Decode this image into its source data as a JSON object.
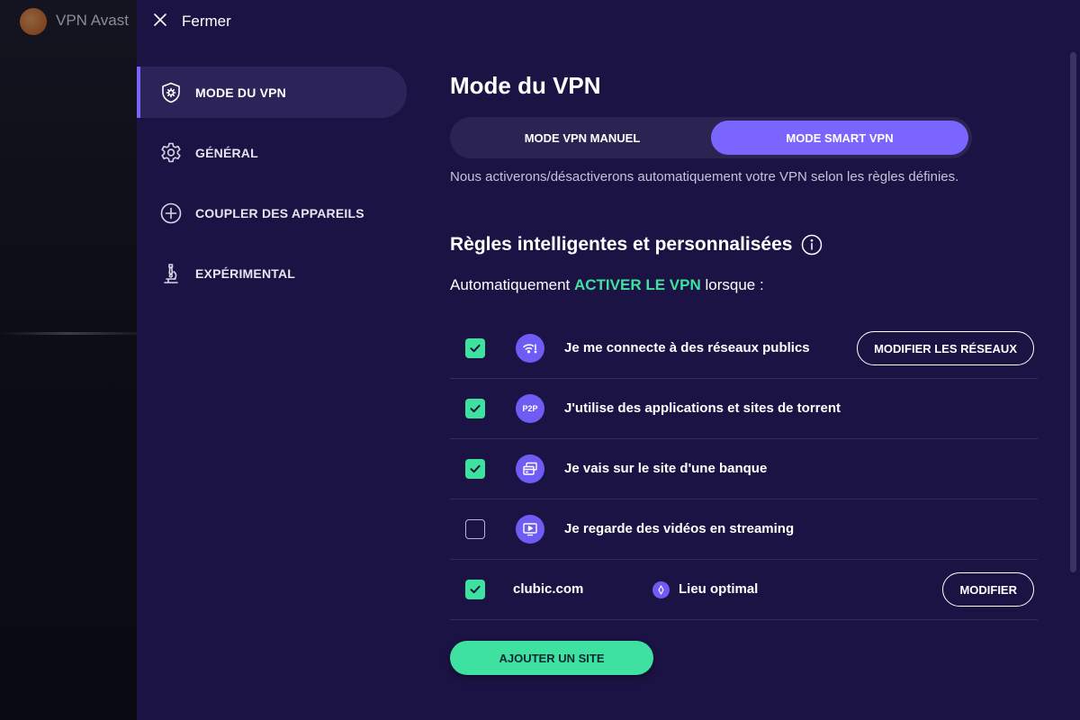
{
  "background_app": {
    "title": "VPN Avast"
  },
  "topbar": {
    "close_label": "Fermer"
  },
  "sidebar": {
    "items": [
      {
        "label": "MODE DU VPN",
        "icon": "shield-gear-icon",
        "active": true
      },
      {
        "label": "GÉNÉRAL",
        "icon": "gear-icon",
        "active": false
      },
      {
        "label": "COUPLER DES APPAREILS",
        "icon": "plus-circle-icon",
        "active": false
      },
      {
        "label": "EXPÉRIMENTAL",
        "icon": "microscope-icon",
        "active": false
      }
    ]
  },
  "main": {
    "title": "Mode du VPN",
    "modes": [
      {
        "label": "MODE VPN MANUEL",
        "selected": false
      },
      {
        "label": "MODE SMART VPN",
        "selected": true
      }
    ],
    "mode_description": "Nous activerons/désactiverons automatiquement votre VPN selon les règles définies.",
    "rules_title": "Règles intelligentes et personnalisées",
    "auto_prefix": "Automatiquement",
    "auto_accent": "ACTIVER LE VPN",
    "auto_suffix": "lorsque :",
    "rules": [
      {
        "label": "Je me connecte à des réseaux publics",
        "icon": "wifi-alert-icon",
        "checked": true,
        "button": "MODIFIER LES RÉSEAUX"
      },
      {
        "label": "J'utilise des applications et sites de torrent",
        "icon": "p2p-icon",
        "icon_text": "P2P",
        "checked": true
      },
      {
        "label": "Je vais sur le site d'une banque",
        "icon": "bank-card-icon",
        "checked": true
      },
      {
        "label": "Je regarde des vidéos en streaming",
        "icon": "video-play-icon",
        "checked": false
      }
    ],
    "site_rule": {
      "site": "clubic.com",
      "location": "Lieu optimal",
      "checked": true,
      "button": "MODIFIER"
    },
    "add_site_label": "AJOUTER UN SITE"
  },
  "colors": {
    "panel_bg": "#1b1344",
    "accent_purple": "#7a66ff",
    "accent_green": "#3fe1a0",
    "nav_active_bg": "#2c2458"
  }
}
